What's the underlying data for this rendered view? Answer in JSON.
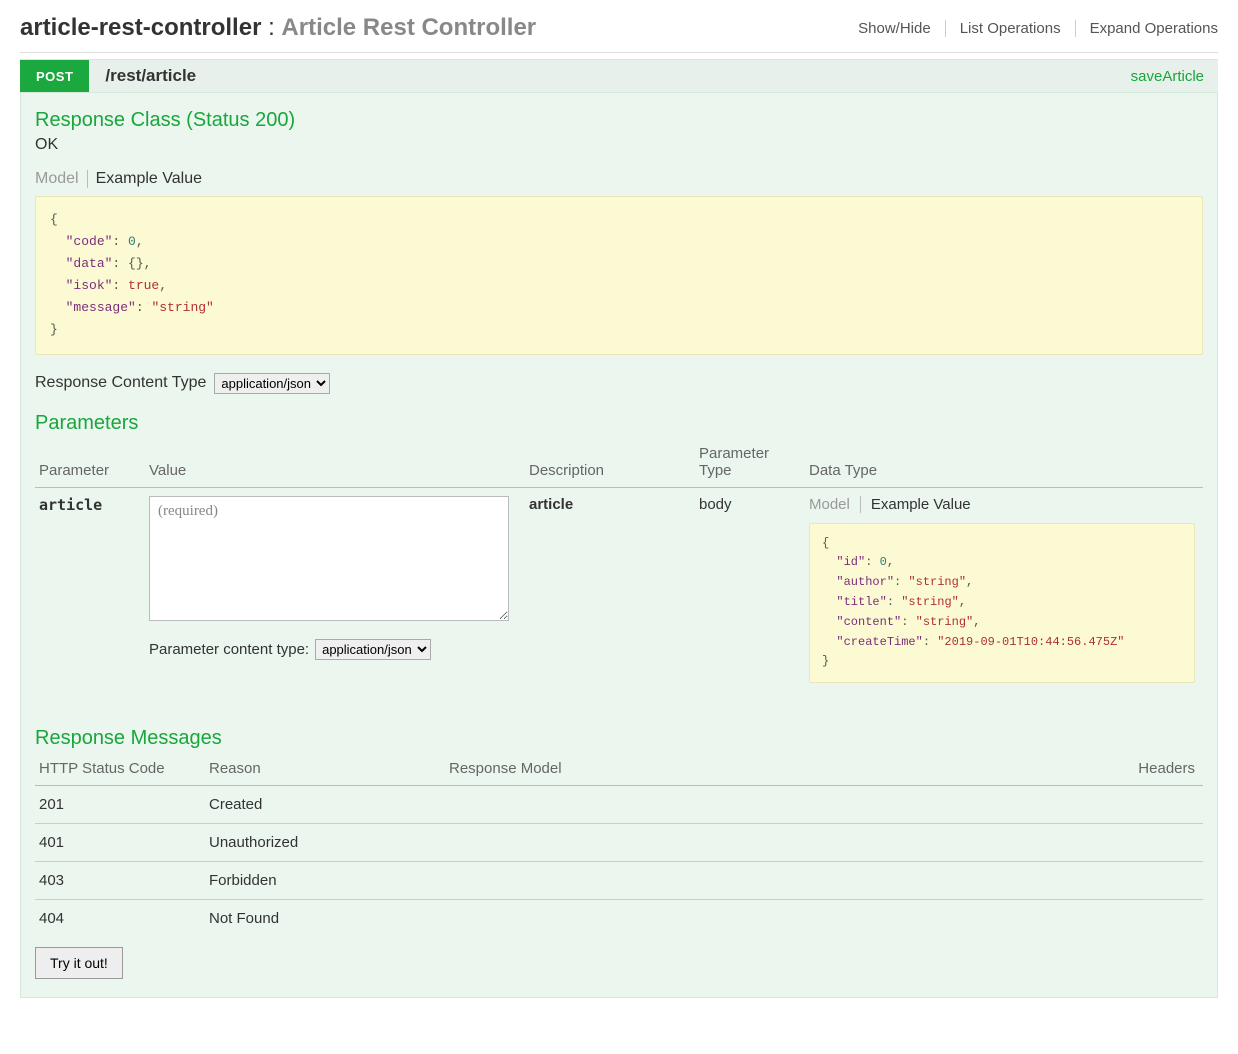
{
  "controller": {
    "name": "article-rest-controller",
    "separator": " : ",
    "description": "Article Rest Controller"
  },
  "headerActions": {
    "showHide": "Show/Hide",
    "listOps": "List Operations",
    "expandOps": "Expand Operations"
  },
  "operation": {
    "method": "POST",
    "path": "/rest/article",
    "nickname": "saveArticle"
  },
  "responseClass": {
    "heading": "Response Class (Status 200)",
    "statusText": "OK",
    "tabModel": "Model",
    "tabExample": "Example Value",
    "exampleLines": [
      {
        "t": "punct",
        "v": "{"
      },
      {
        "t": "kv",
        "indent": 1,
        "key": "\"code\"",
        "val": "0",
        "valClass": "j-num",
        "comma": true
      },
      {
        "t": "kv",
        "indent": 1,
        "key": "\"data\"",
        "val": "{}",
        "valClass": "",
        "comma": true
      },
      {
        "t": "kv",
        "indent": 1,
        "key": "\"isok\"",
        "val": "true",
        "valClass": "j-bool",
        "comma": true
      },
      {
        "t": "kv",
        "indent": 1,
        "key": "\"message\"",
        "val": "\"string\"",
        "valClass": "j-str",
        "comma": false
      },
      {
        "t": "punct",
        "v": "}"
      }
    ]
  },
  "responseContentType": {
    "label": "Response Content Type",
    "selected": "application/json"
  },
  "parameters": {
    "heading": "Parameters",
    "cols": {
      "param": "Parameter",
      "value": "Value",
      "desc": "Description",
      "ptype": "Parameter Type",
      "dtype": "Data Type"
    },
    "row": {
      "name": "article",
      "placeholder": "(required)",
      "description": "article",
      "paramType": "body"
    },
    "paramContent": {
      "label": "Parameter content type:",
      "selected": "application/json"
    },
    "dataTypeTabs": {
      "model": "Model",
      "example": "Example Value"
    },
    "exampleLines": [
      {
        "t": "punct",
        "v": "{"
      },
      {
        "t": "kv",
        "indent": 1,
        "key": "\"id\"",
        "val": "0",
        "valClass": "j-num",
        "comma": true
      },
      {
        "t": "kv",
        "indent": 1,
        "key": "\"author\"",
        "val": "\"string\"",
        "valClass": "j-str",
        "comma": true
      },
      {
        "t": "kv",
        "indent": 1,
        "key": "\"title\"",
        "val": "\"string\"",
        "valClass": "j-str",
        "comma": true
      },
      {
        "t": "kv",
        "indent": 1,
        "key": "\"content\"",
        "val": "\"string\"",
        "valClass": "j-str",
        "comma": true
      },
      {
        "t": "kv",
        "indent": 1,
        "key": "\"createTime\"",
        "val": "\"2019-09-01T10:44:56.475Z\"",
        "valClass": "j-str",
        "comma": false
      },
      {
        "t": "punct",
        "v": "}"
      }
    ]
  },
  "responseMessages": {
    "heading": "Response Messages",
    "cols": {
      "status": "HTTP Status Code",
      "reason": "Reason",
      "model": "Response Model",
      "headers": "Headers"
    },
    "rows": [
      {
        "status": "201",
        "reason": "Created"
      },
      {
        "status": "401",
        "reason": "Unauthorized"
      },
      {
        "status": "403",
        "reason": "Forbidden"
      },
      {
        "status": "404",
        "reason": "Not Found"
      }
    ]
  },
  "tryButton": "Try it out!"
}
